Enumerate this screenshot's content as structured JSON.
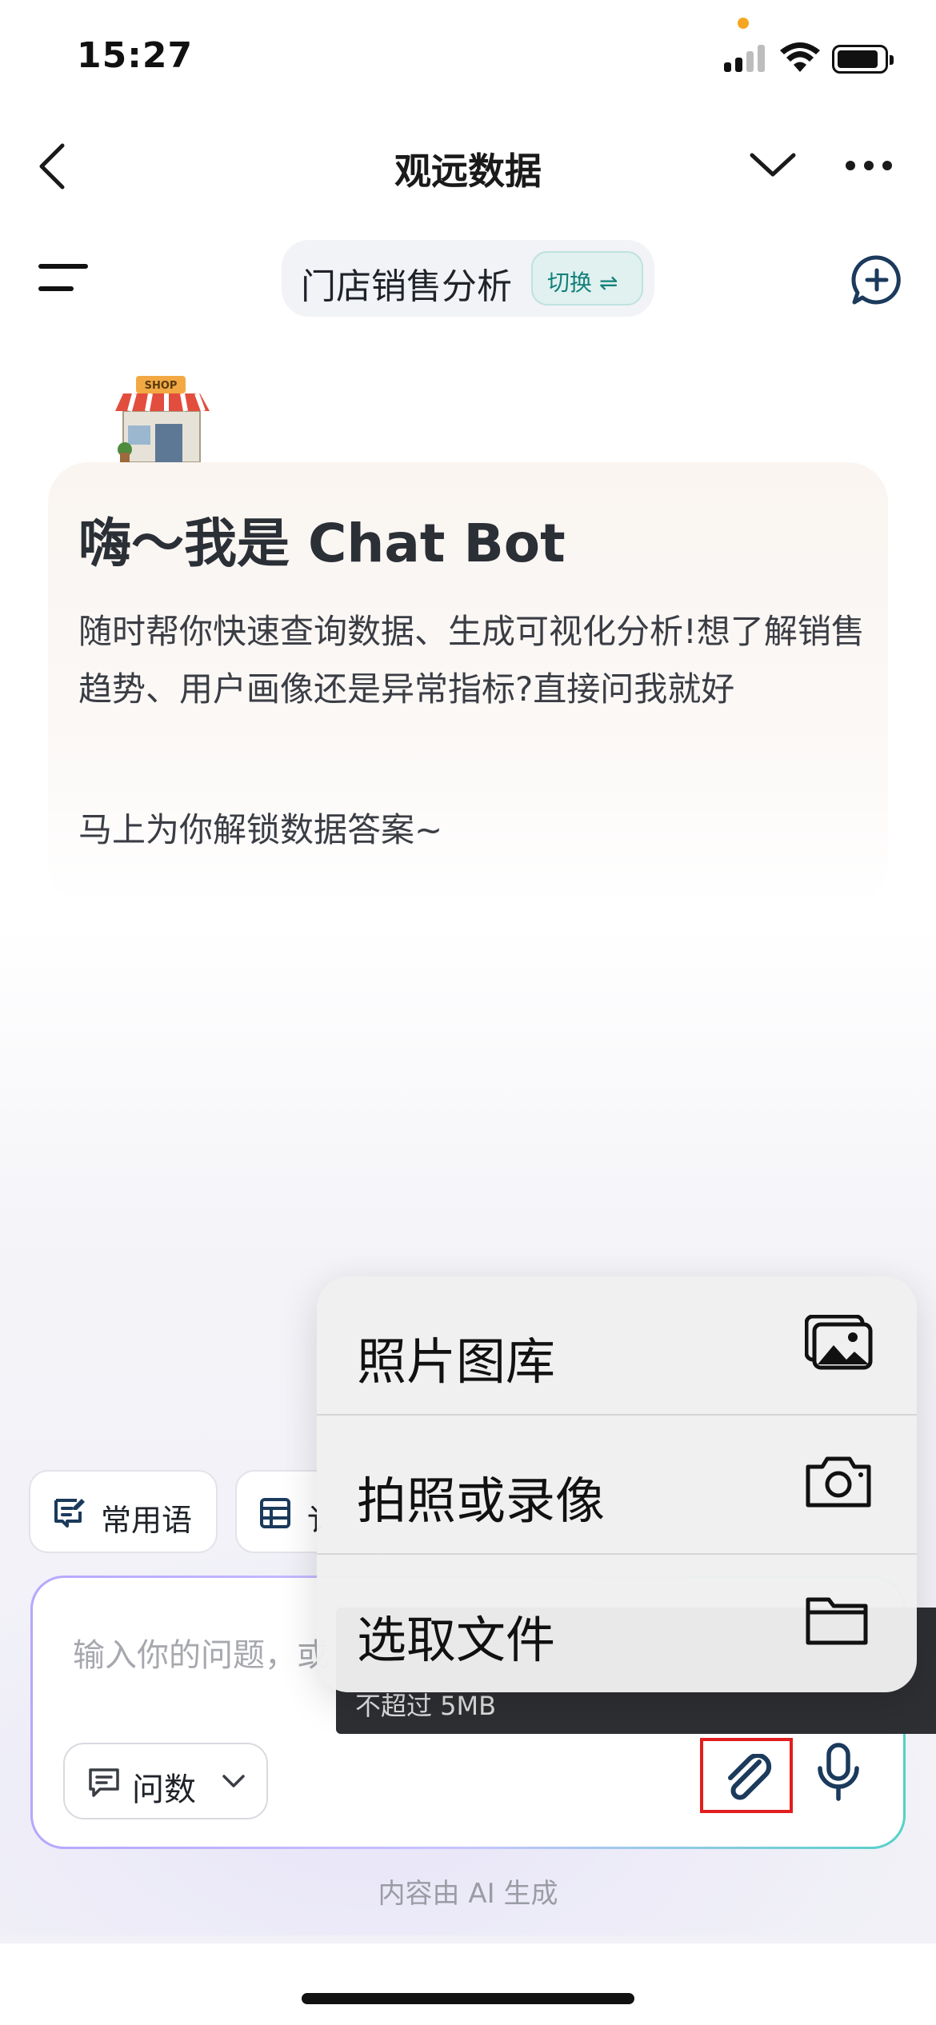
{
  "status_bar": {
    "time": "15:27"
  },
  "nav": {
    "title": "观远数据"
  },
  "toolbar": {
    "topic": "门店销售分析",
    "switch_label": "切换 ⇌"
  },
  "welcome": {
    "title": "嗨～我是 Chat Bot",
    "description": "随时帮你快速查询数据、生成可视化分析!想了解销售趋势、用户画像还是异常指标?直接问我就好",
    "cta": "马上为你解锁数据答案~"
  },
  "quick_chips": [
    {
      "label": "常用语",
      "icon": "edit-note-icon"
    },
    {
      "label": "讠",
      "icon": "table-icon"
    }
  ],
  "input": {
    "placeholder": "输入你的问题，或",
    "mode_label": "问数"
  },
  "tooltip": {
    "text": "不超过 5MB"
  },
  "attach_menu": {
    "items": [
      {
        "label": "照片图库",
        "icon": "photo-library-icon"
      },
      {
        "label": "拍照或录像",
        "icon": "camera-icon"
      },
      {
        "label": "选取文件",
        "icon": "folder-icon"
      }
    ]
  },
  "footer": {
    "ai_note": "内容由 AI 生成"
  },
  "colors": {
    "accent_teal": "#13807a",
    "highlight_red": "#e21e1e",
    "status_dot": "#f5a623"
  }
}
